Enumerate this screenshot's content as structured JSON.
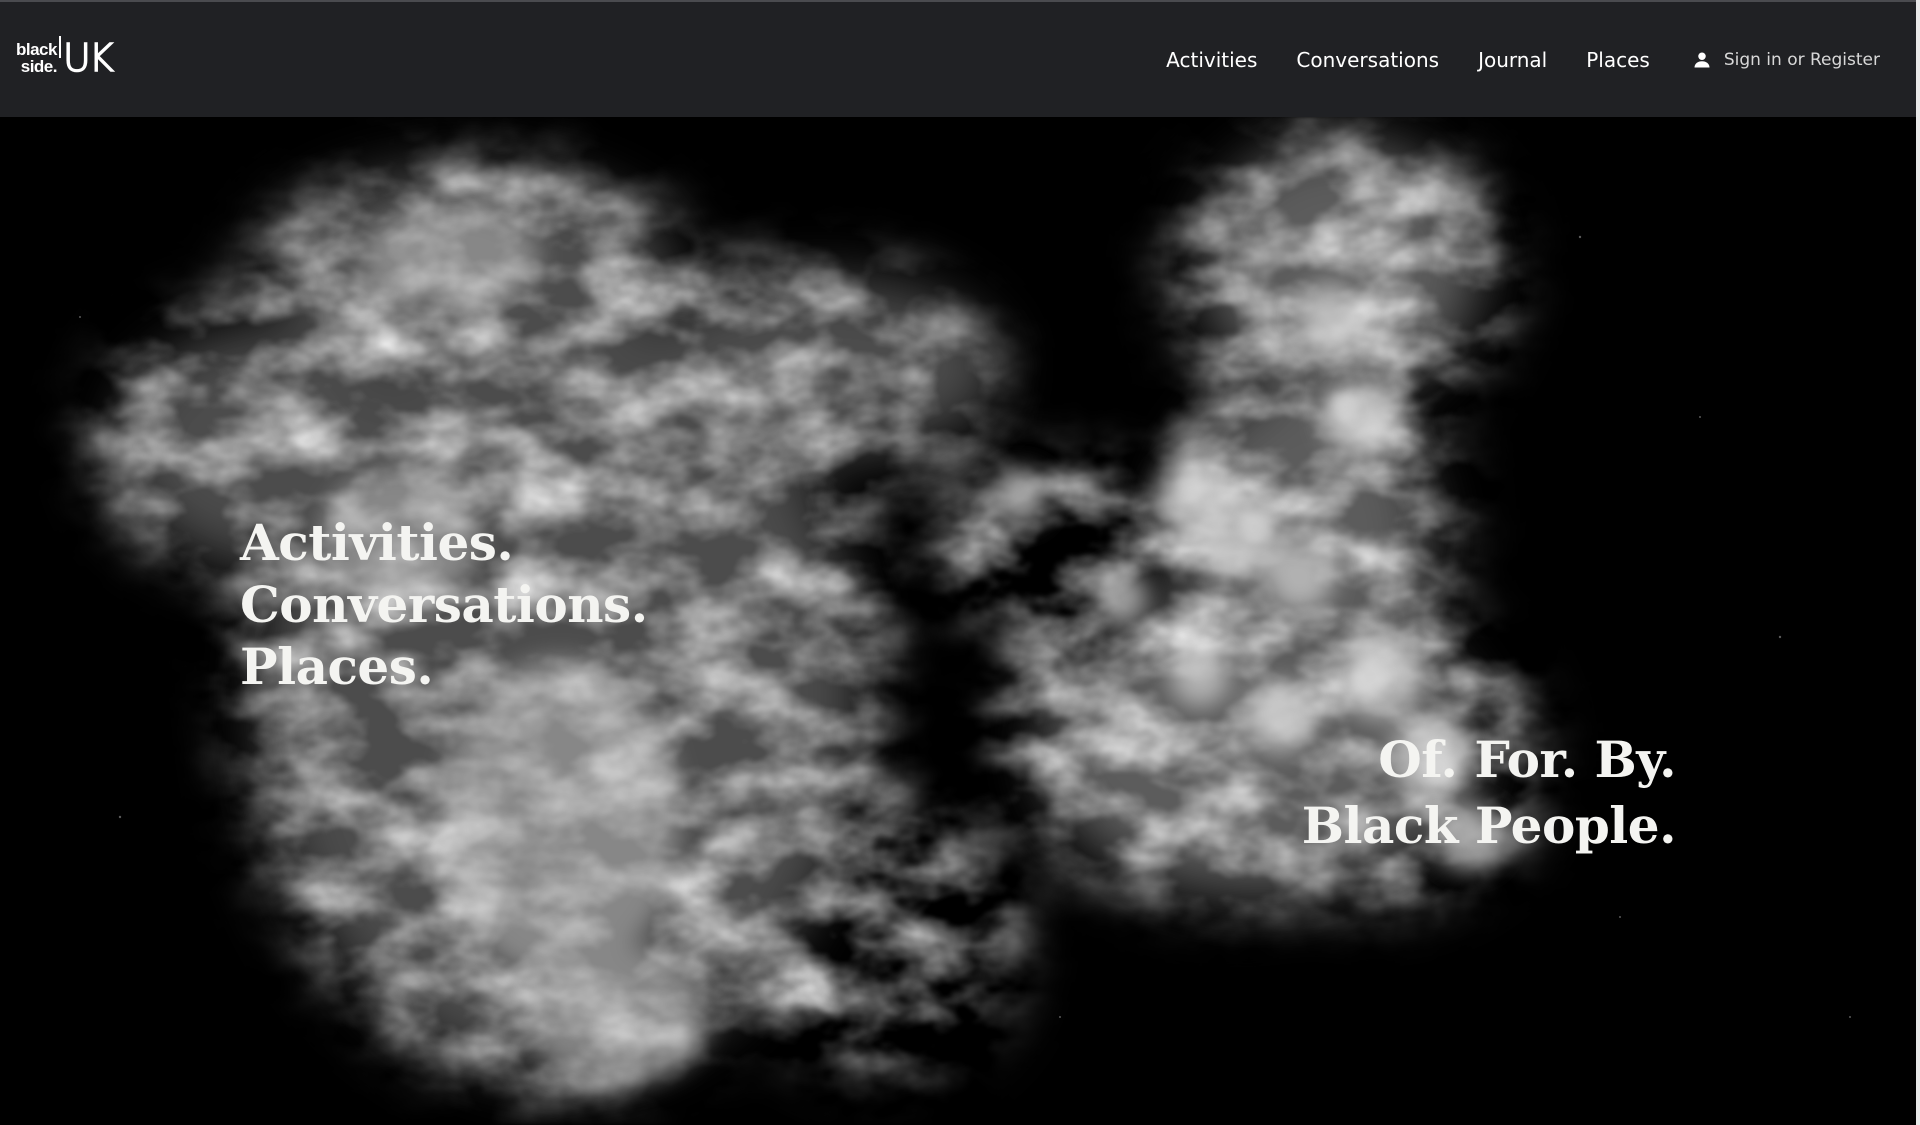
{
  "header": {
    "logo": {
      "line1": "black",
      "line2": "side.",
      "suffix": "UK"
    },
    "nav": [
      {
        "label": "Activities"
      },
      {
        "label": "Conversations"
      },
      {
        "label": "Journal"
      },
      {
        "label": "Places"
      }
    ],
    "signin_label": "Sign in or Register",
    "signin_icon": "user-icon"
  },
  "hero": {
    "left_lines": [
      "Activities.",
      "Conversations.",
      "Places."
    ],
    "right_lines": [
      "Of. For. By.",
      "Black People."
    ]
  },
  "colors": {
    "navbar_bg": "#202124",
    "hero_bg": "#000000",
    "text": "#f4f4f1"
  }
}
